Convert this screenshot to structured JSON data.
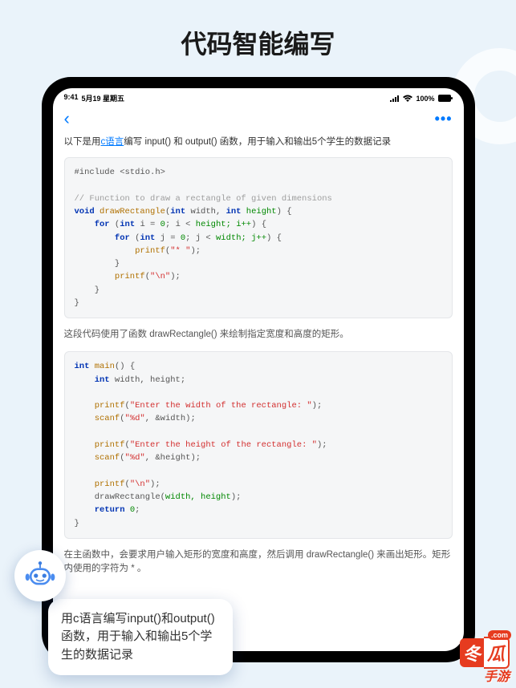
{
  "page": {
    "title": "代码智能编写"
  },
  "status": {
    "time": "9:41",
    "date": "5月19 星期五",
    "battery": "100%"
  },
  "intro": {
    "prefix": "以下是用",
    "link": "c语言",
    "suffix": "编写 input() 和 output() 函数，用于输入和输出5个学生的数据记录"
  },
  "code1": {
    "l1": "#include <stdio.h>",
    "l2": "// Function to draw a rectangle of given dimensions",
    "l3a": "void ",
    "l3b": "drawRectangle",
    "l3c": "(",
    "l3d": "int",
    "l3e": " width, ",
    "l3f": "int",
    "l3g": " height",
    "l3h": ") {",
    "l4a": "    for ",
    "l4b": "(",
    "l4c": "int",
    "l4d": " i = ",
    "l4e": "0",
    "l4f": "; i < ",
    "l4g": "height; i++",
    "l4h": ") {",
    "l5a": "        for ",
    "l5b": "(",
    "l5c": "int",
    "l5d": " j = ",
    "l5e": "0",
    "l5f": "; j < ",
    "l5g": "width; j++",
    "l5h": ") {",
    "l6a": "            printf",
    "l6b": "(",
    "l6c": "\"* \"",
    "l6d": ");",
    "l7": "        }",
    "l8a": "        printf",
    "l8b": "(",
    "l8c": "\"\\n\"",
    "l8d": ");",
    "l9": "    }",
    "l10": "}"
  },
  "desc1": "这段代码使用了函数 drawRectangle() 来绘制指定宽度和高度的矩形。",
  "code2": {
    "l1a": "int ",
    "l1b": "main",
    "l1c": "() {",
    "l2a": "    int",
    "l2b": " width, height;",
    "l3a": "    printf",
    "l3b": "(",
    "l3c": "\"Enter the width of the rectangle: \"",
    "l3d": ");",
    "l4a": "    scanf",
    "l4b": "(",
    "l4c": "\"%d\"",
    "l4d": ", &width);",
    "l5a": "    printf",
    "l5b": "(",
    "l5c": "\"Enter the height of the rectangle: \"",
    "l5d": ");",
    "l6a": "    scanf",
    "l6b": "(",
    "l6c": "\"%d\"",
    "l6d": ", &height);",
    "l7a": "    printf",
    "l7b": "(",
    "l7c": "\"\\n\"",
    "l7d": ");",
    "l8a": "    drawRectangle(",
    "l8b": "width, height",
    "l8c": ");",
    "l9a": "    return ",
    "l9b": "0",
    "l9c": ";",
    "l10": "}"
  },
  "desc2": "在主函数中，会要求用户输入矩形的宽度和高度，然后调用 drawRectangle() 来画出矩形。矩形内使用的字符为 * 。",
  "bubble": "用c语言编写input()和output()函数，用于输入和输出5个学生的数据记录",
  "watermark": {
    "a": "冬",
    "b": "瓜",
    "com": ".com",
    "sub": "手游"
  }
}
